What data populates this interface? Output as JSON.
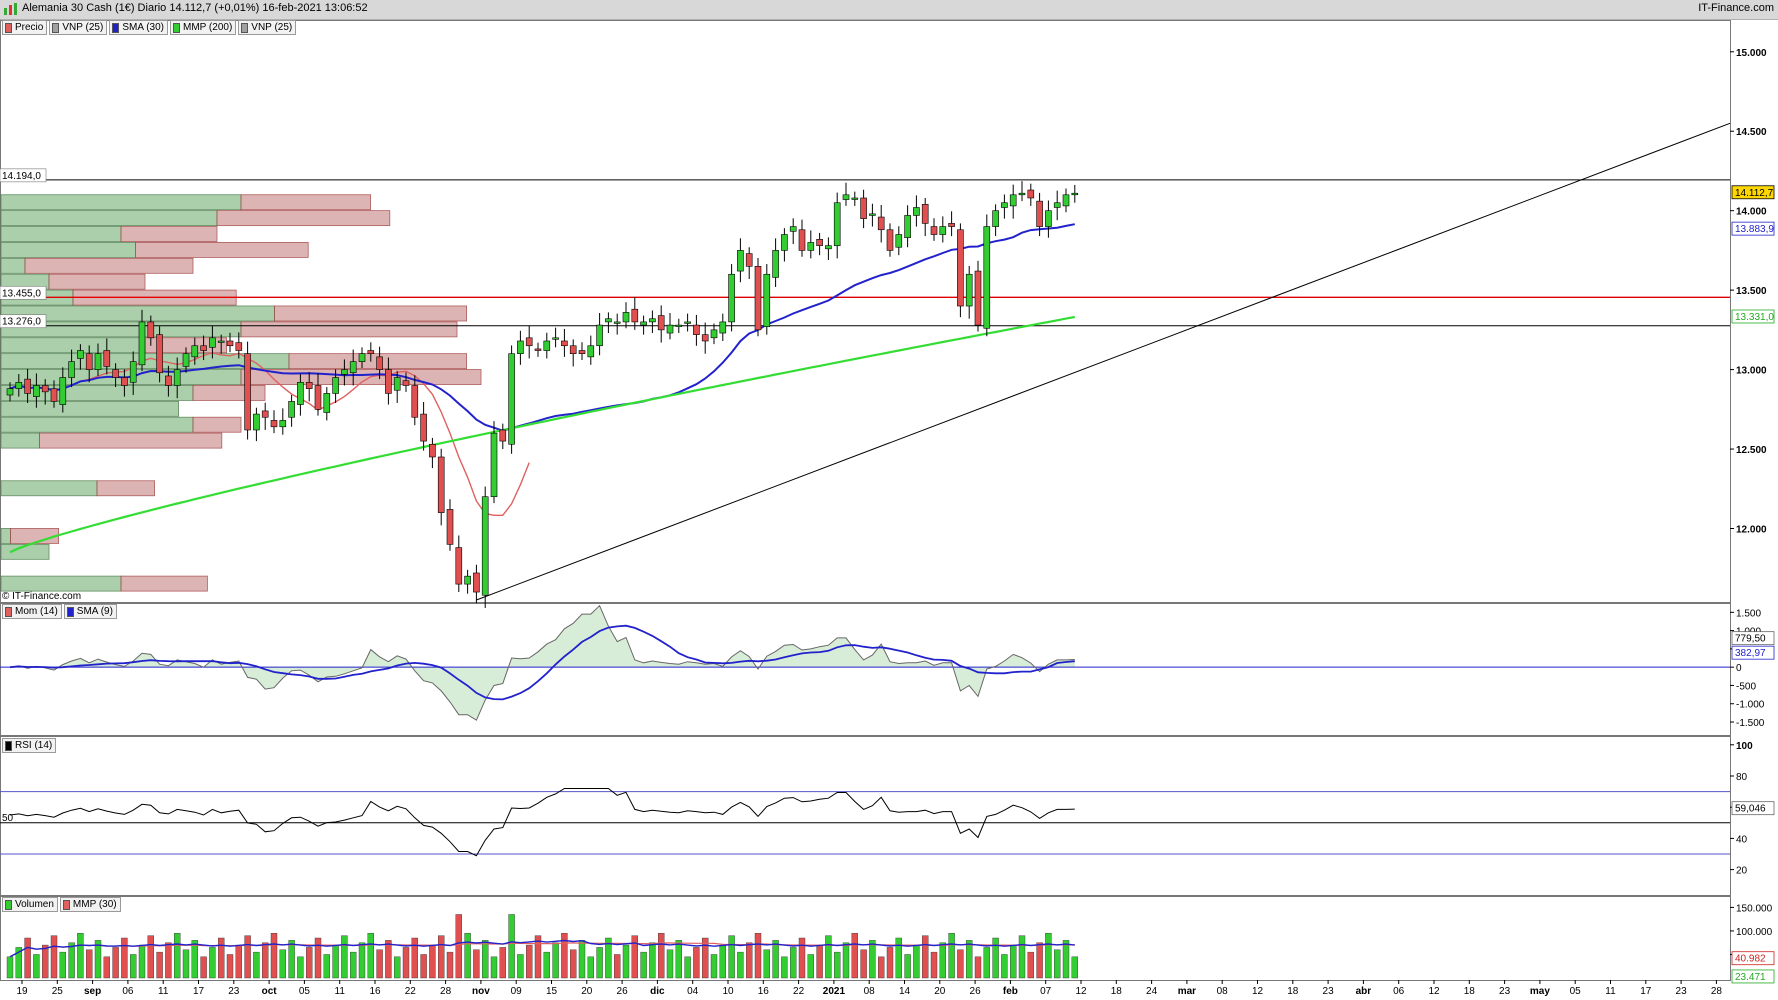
{
  "window": {
    "title": "Alemania 30 Cash (1€) Diario 14.112,7 (+0,01%) 16-feb-2021 13:06:52",
    "site": "IT-Finance.com",
    "watermark": "© IT-Finance.com"
  },
  "legends": {
    "price": [
      {
        "label": "Precio",
        "color": "#e06060"
      },
      {
        "label": "VNP (25)",
        "color": "#a0a0a0"
      },
      {
        "label": "SMA (30)",
        "color": "#2222cc"
      },
      {
        "label": "MMP (200)",
        "color": "#33cc33"
      },
      {
        "label": "VNP (25)",
        "color": "#a0a0a0"
      }
    ],
    "momentum": [
      {
        "label": "Mom (14)",
        "color": "#e06060"
      },
      {
        "label": "SMA (9)",
        "color": "#2222cc"
      }
    ],
    "rsi": [
      {
        "label": "RSI (14)",
        "color": "#000000"
      }
    ],
    "volume": [
      {
        "label": "Volumen",
        "color": "#33cc33"
      },
      {
        "label": "MMP (30)",
        "color": "#e06060"
      }
    ]
  },
  "price_tags": {
    "resistance_label": "14.194,0",
    "support1_label": "13.455,0",
    "support2_label": "13.276,0",
    "last_price": "14.112,7",
    "sma30": "13.883,9",
    "ma200": "13.331,0",
    "mom": "779,50",
    "mom_sma": "382,97",
    "rsi": "59,046",
    "vol": "40.982",
    "vol_ma": "23.471",
    "rsi_left_50": "50"
  },
  "colors": {
    "up": "#33cc33",
    "down": "#e05050",
    "sma30": "#2222cc",
    "ma200": "#33dd33",
    "ma_short": "#e06060",
    "support_line": "#e00000",
    "last_tag_bg": "#ffd700"
  },
  "chart_data": {
    "type": "candlestick",
    "title": "Alemania 30 Cash (1€) Diario 14.112,7 (+0,01%) 16-feb-2021 13:06:52",
    "y_axis": {
      "ticks": [
        "15.000",
        "14.500",
        "14.000",
        "13.500",
        "13.000",
        "12.500",
        "12.000"
      ],
      "range": [
        11.6,
        15.2
      ],
      "unit": "thousands"
    },
    "x_axis": {
      "tick_labels": [
        "19",
        "25",
        "sep",
        "06",
        "11",
        "17",
        "23",
        "oct",
        "05",
        "11",
        "16",
        "22",
        "28",
        "nov",
        "09",
        "15",
        "20",
        "26",
        "dic",
        "04",
        "10",
        "16",
        "22",
        "2021",
        "08",
        "14",
        "20",
        "26",
        "feb",
        "07",
        "12",
        "18",
        "24",
        "mar",
        "08",
        "12",
        "18",
        "23",
        "abr",
        "06",
        "12",
        "18",
        "23",
        "may",
        "05",
        "11",
        "17",
        "23",
        "28"
      ],
      "bold_labels": [
        "sep",
        "oct",
        "nov",
        "dic",
        "2021",
        "feb",
        "mar",
        "abr",
        "may"
      ]
    },
    "closes": [
      12.88,
      12.92,
      12.85,
      12.9,
      12.86,
      12.8,
      12.95,
      13.05,
      13.12,
      13.0,
      13.1,
      13.02,
      12.95,
      12.9,
      13.05,
      13.3,
      13.2,
      12.98,
      12.9,
      13.0,
      13.1,
      13.15,
      13.12,
      13.2,
      13.18,
      13.15,
      13.12,
      12.62,
      12.72,
      12.7,
      12.64,
      12.68,
      12.8,
      12.92,
      12.88,
      12.75,
      12.85,
      12.95,
      13.0,
      13.05,
      13.1,
      13.1,
      13.0,
      12.85,
      12.95,
      12.9,
      12.7,
      12.55,
      12.45,
      12.1,
      11.9,
      11.65,
      11.7,
      11.6,
      12.2,
      12.6,
      12.55,
      13.1,
      13.18,
      13.15,
      13.12,
      13.18,
      13.2,
      13.15,
      13.1,
      13.1,
      13.15,
      13.28,
      13.32,
      13.3,
      13.36,
      13.3,
      13.3,
      13.32,
      13.25,
      13.28,
      13.28,
      13.3,
      13.22,
      13.18,
      13.25,
      13.3,
      13.6,
      13.75,
      13.65,
      13.25,
      13.6,
      13.75,
      13.85,
      13.9,
      13.75,
      13.8,
      13.78,
      13.78,
      14.05,
      14.1,
      14.08,
      13.95,
      13.98,
      13.88,
      13.75,
      13.85,
      13.97,
      14.02,
      13.92,
      13.85,
      13.9,
      13.9,
      13.4,
      13.6,
      13.28,
      13.9,
      14.0,
      14.05,
      14.1,
      14.11,
      14.08,
      13.9,
      14.0,
      14.05,
      14.1,
      14.11
    ],
    "levels": {
      "resistance": 14.194,
      "support_red": 13.455,
      "support_black": 13.276
    },
    "trendline": {
      "from": {
        "bar": 53,
        "value": 11.55
      },
      "to": {
        "label": "28",
        "value": 14.55
      }
    },
    "sma30_last": 13.8839,
    "ma200_last": 13.331,
    "volume_profile": [
      {
        "price": 14.05,
        "up": 0.5,
        "down": 0.27
      },
      {
        "price": 13.95,
        "up": 0.45,
        "down": 0.36
      },
      {
        "price": 13.85,
        "up": 0.25,
        "down": 0.2
      },
      {
        "price": 13.75,
        "up": 0.28,
        "down": 0.36
      },
      {
        "price": 13.65,
        "up": 0.05,
        "down": 0.35
      },
      {
        "price": 13.55,
        "up": 0.1,
        "down": 0.2
      },
      {
        "price": 13.45,
        "up": 0.15,
        "down": 0.34
      },
      {
        "price": 13.35,
        "up": 0.57,
        "down": 0.4
      },
      {
        "price": 13.25,
        "up": 0.5,
        "down": 0.45
      },
      {
        "price": 13.15,
        "up": 0.3,
        "down": 0.17
      },
      {
        "price": 13.05,
        "up": 0.6,
        "down": 0.37
      },
      {
        "price": 12.95,
        "up": 0.5,
        "down": 0.5
      },
      {
        "price": 12.85,
        "up": 0.4,
        "down": 0.15
      },
      {
        "price": 12.75,
        "up": 0.37,
        "down": 0.0
      },
      {
        "price": 12.65,
        "up": 0.4,
        "down": 0.1
      },
      {
        "price": 12.55,
        "up": 0.08,
        "down": 0.38
      },
      {
        "price": 12.25,
        "up": 0.2,
        "down": 0.12
      },
      {
        "price": 11.95,
        "up": 0.02,
        "down": 0.1
      },
      {
        "price": 11.85,
        "up": 0.1,
        "down": 0.0
      },
      {
        "price": 11.65,
        "up": 0.25,
        "down": 0.18
      }
    ],
    "momentum": {
      "ticks": [
        "1.500",
        "1.000",
        "500",
        "0",
        "-500",
        "-1.000",
        "-1.500"
      ],
      "last": 779.5,
      "sma_last": 382.97
    },
    "rsi": {
      "ticks": [
        "100",
        "80",
        "60",
        "40",
        "20"
      ],
      "levels": [
        70,
        50,
        30
      ],
      "last": 59.046
    },
    "volume": {
      "ticks": [
        "150.000",
        "100.000",
        "50.000"
      ],
      "last": 40982,
      "ma_last": 23471
    }
  }
}
